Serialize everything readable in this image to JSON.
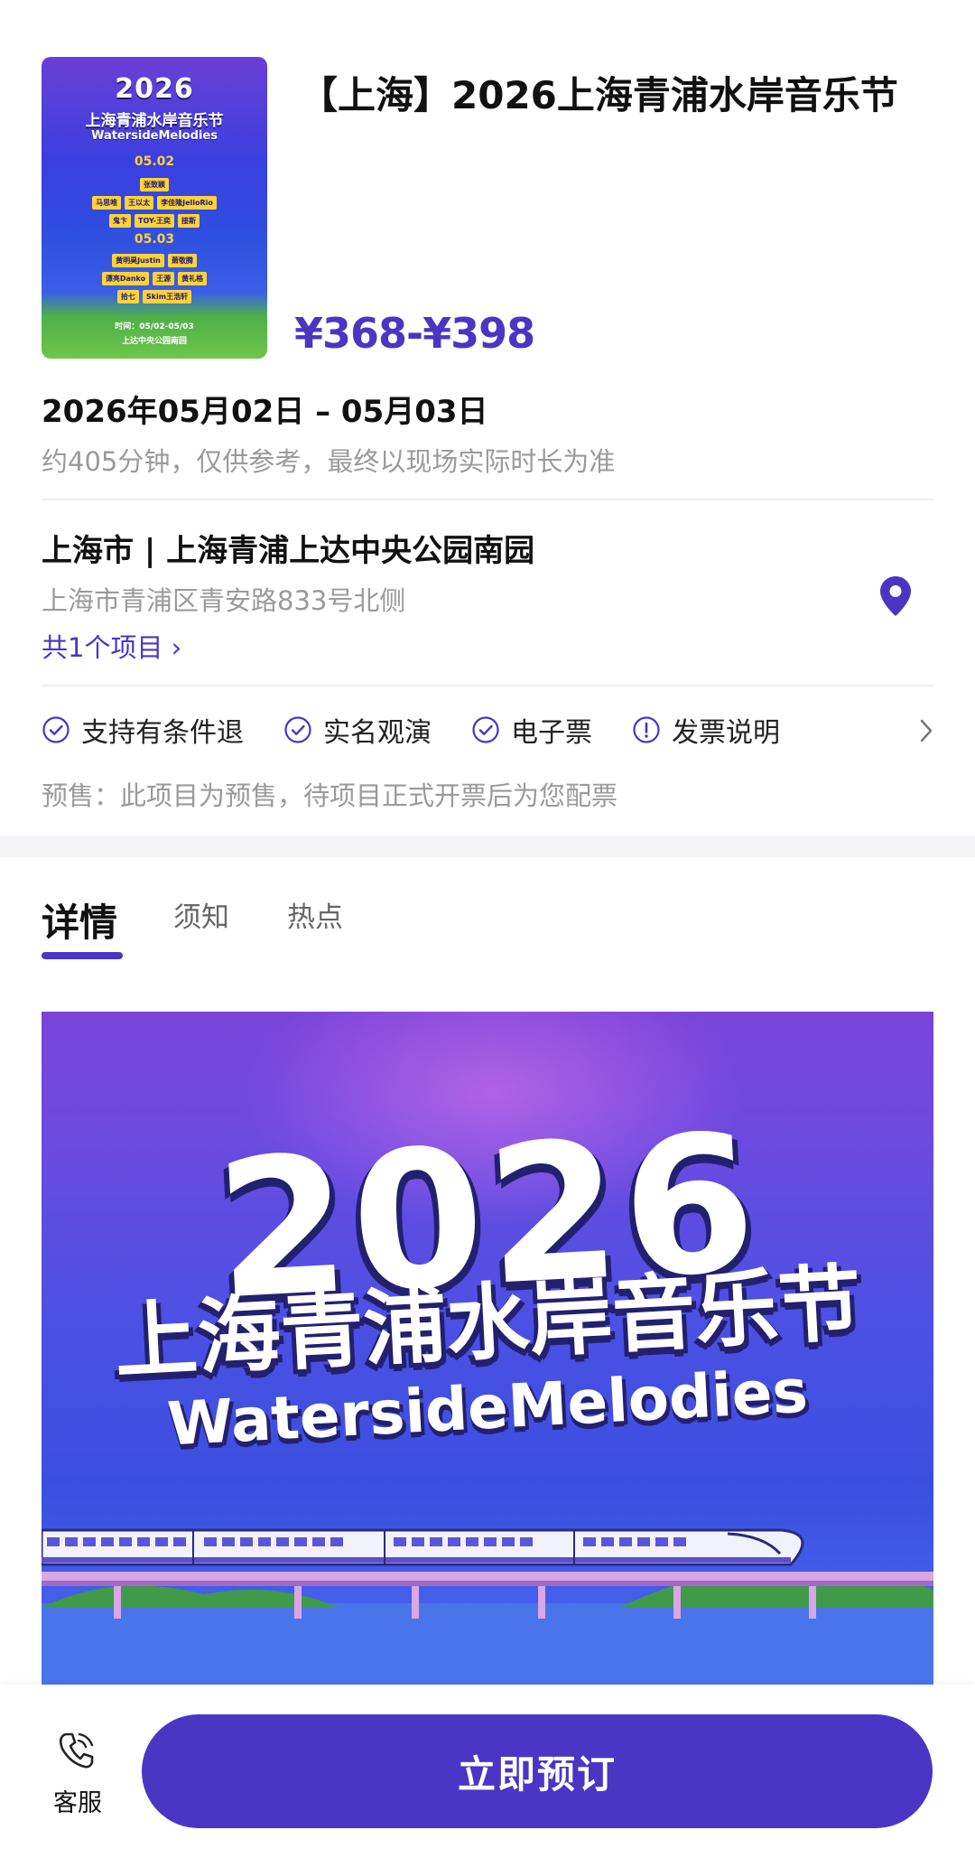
{
  "poster": {
    "year": "2026",
    "title_cn": "上海青浦水岸音乐节",
    "title_en": "WatersideMelodies",
    "day1": "05.02",
    "day1_rows": [
      [
        "张致颖"
      ],
      [
        "马思唯",
        "王以太",
        "李佳隆JelloRio"
      ],
      [
        "鬼卞",
        "TOY-王奕",
        "接斯"
      ]
    ],
    "day2": "05.03",
    "day2_rows": [
      [
        "黄明昊Justin",
        "萧敬腾"
      ],
      [
        "谭亮Danko",
        "王源",
        "黄礼格"
      ],
      [
        "拾七",
        "Skim王浩轩"
      ]
    ],
    "time_line": "时间：05/02-05/03",
    "venue_line": "上达中央公园南园"
  },
  "event": {
    "title": "【上海】2026上海青浦水岸音乐节",
    "price": "¥368-¥398",
    "date": "2026年05月02日 – 05月03日",
    "duration": "约405分钟，仅供参考，最终以现场实际时长为准"
  },
  "venue": {
    "name": "上海市 | 上海青浦上达中央公园南园",
    "address": "上海市青浦区青安路833号北侧",
    "projects_link": "共1个项目 ›"
  },
  "features": [
    {
      "label": "支持有条件退",
      "icon": "check-circle-icon"
    },
    {
      "label": "实名观演",
      "icon": "check-circle-icon"
    },
    {
      "label": "电子票",
      "icon": "check-circle-icon"
    },
    {
      "label": "发票说明",
      "icon": "info-circle-icon"
    }
  ],
  "presale_note": "预售：此项目为预售，待项目正式开票后为您配票",
  "tabs": [
    {
      "label": "详情",
      "active": true
    },
    {
      "label": "须知",
      "active": false
    },
    {
      "label": "热点",
      "active": false
    }
  ],
  "banner": {
    "year": "2026",
    "title_cn": "上海青浦水岸音乐节",
    "title_en": "WatersideMelodies"
  },
  "bottom_bar": {
    "service_label": "客服",
    "book_label": "立即预订"
  },
  "colors": {
    "accent": "#4b35c4",
    "secondary_text": "#9a9a9a"
  }
}
